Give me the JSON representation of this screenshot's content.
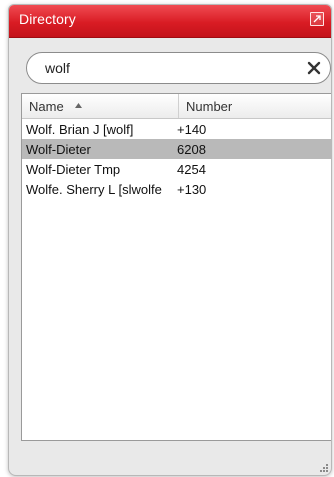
{
  "window": {
    "title": "Directory",
    "accent_color": "#d91c24"
  },
  "search": {
    "value": "wolf",
    "clear_icon": "close-icon"
  },
  "table": {
    "columns": {
      "name": "Name",
      "number": "Number",
      "sort": "ascending"
    },
    "rows": [
      {
        "name": "Wolf. Brian J [wolf]",
        "number": "+140",
        "selected": false
      },
      {
        "name": "Wolf-Dieter",
        "number": "6208",
        "selected": true
      },
      {
        "name": "Wolf-Dieter Tmp",
        "number": "4254",
        "selected": false
      },
      {
        "name": "Wolfe. Sherry L [slwolfe",
        "number": "+130",
        "selected": false
      }
    ],
    "selected_color": "#b9b9b9"
  }
}
